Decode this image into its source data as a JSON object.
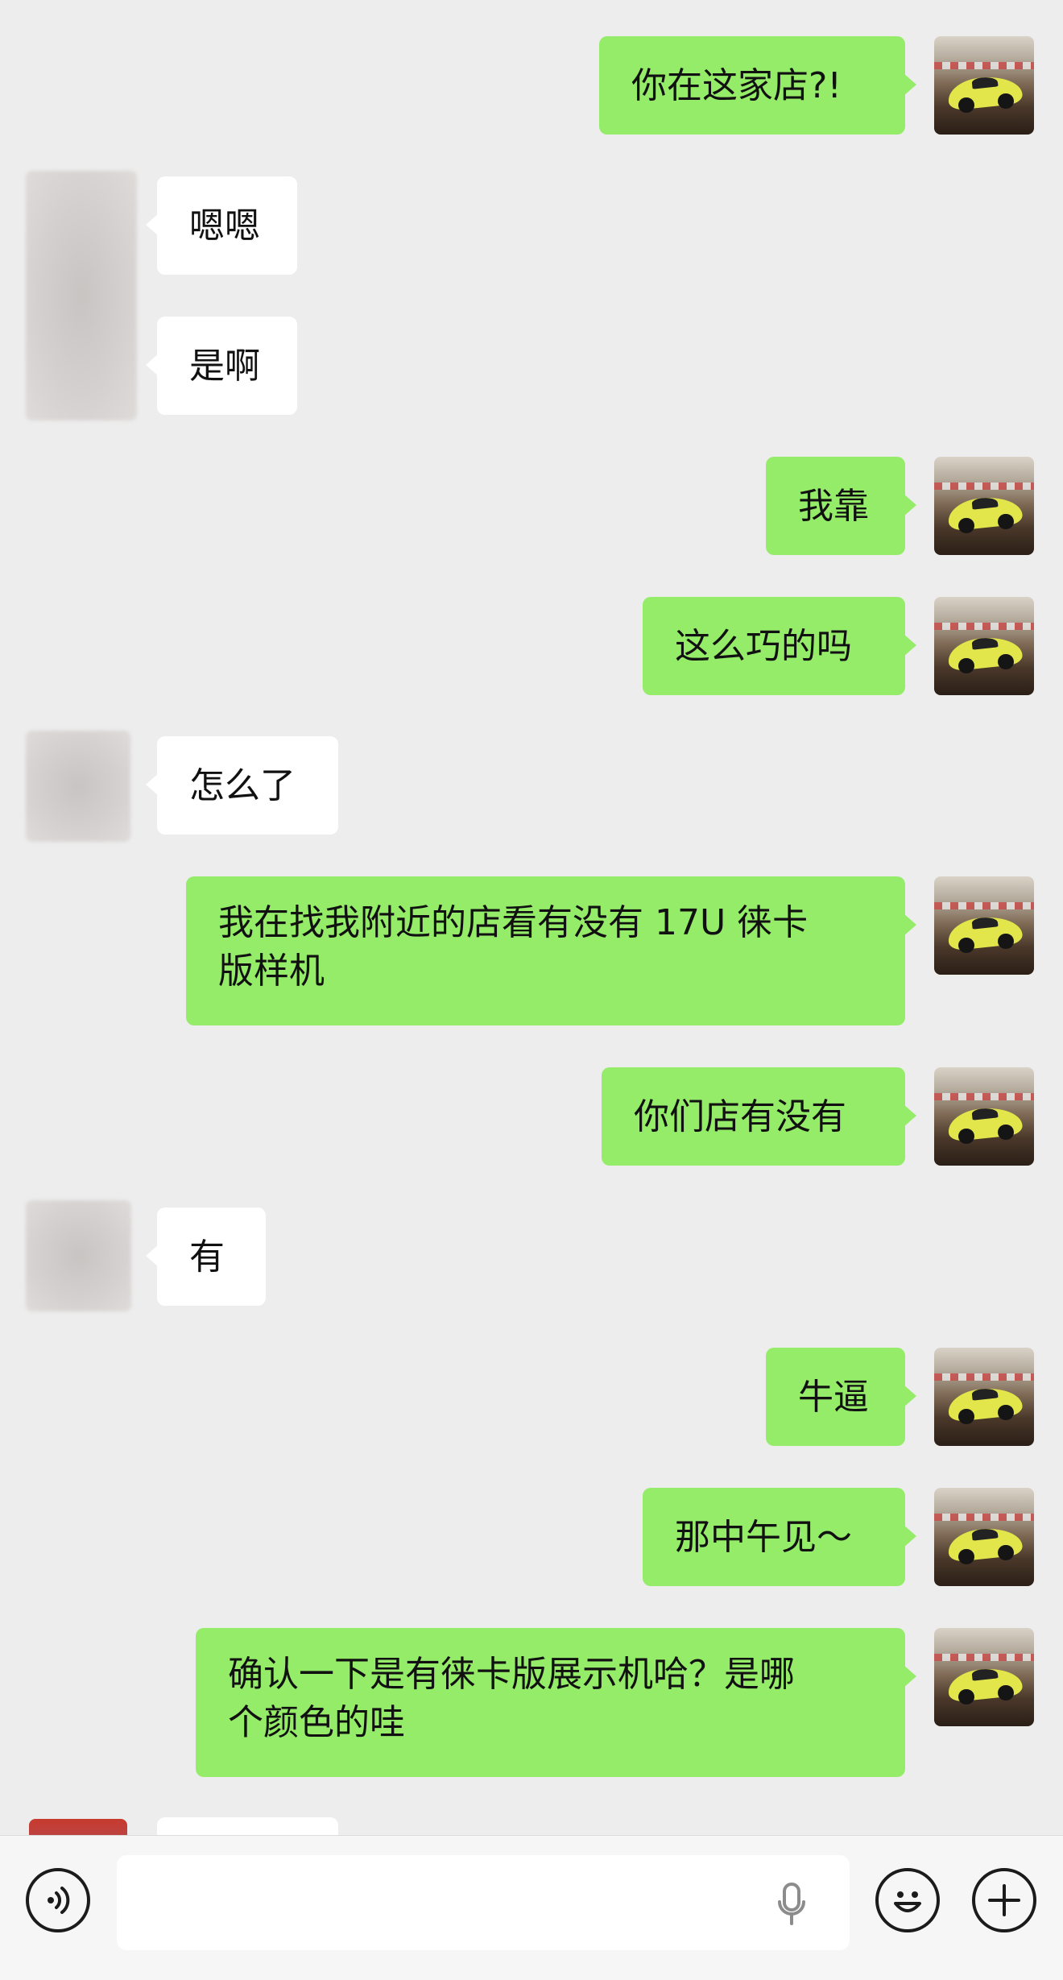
{
  "messages": [
    {
      "side": "right",
      "text": "你在这家店?!"
    },
    {
      "side": "left",
      "text": "嗯嗯"
    },
    {
      "side": "left",
      "text": "是啊"
    },
    {
      "side": "right",
      "text": "我靠"
    },
    {
      "side": "right",
      "text": "这么巧的吗"
    },
    {
      "side": "left",
      "text": "怎么了"
    },
    {
      "side": "right",
      "text": "我在找我附近的店看有没有 17U 徕卡\n版样机"
    },
    {
      "side": "right",
      "text": "你们店有没有"
    },
    {
      "side": "left",
      "text": "有"
    },
    {
      "side": "right",
      "text": "牛逼"
    },
    {
      "side": "right",
      "text": "那中午见～"
    },
    {
      "side": "right",
      "text": "确认一下是有徕卡版展示机哈？是哪\n个颜色的哇"
    }
  ],
  "input_bar": {
    "voice_icon": "voice-wave-icon",
    "mic_icon": "microphone-icon",
    "emoji_icon": "smiley-icon",
    "add_icon": "plus-icon",
    "input_value": ""
  },
  "colors": {
    "my_bubble": "#95ec69",
    "their_bubble": "#ffffff",
    "background": "#ededed"
  }
}
